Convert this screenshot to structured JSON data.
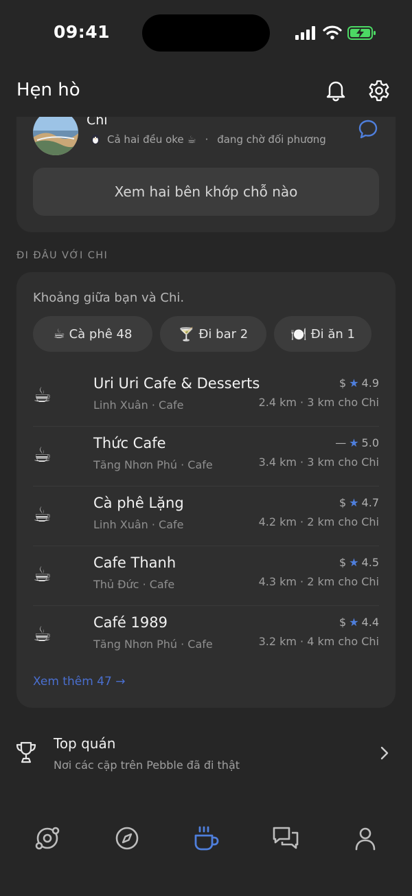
{
  "status": {
    "time": "09:41"
  },
  "header": {
    "title": "Hẹn hò"
  },
  "match": {
    "name": "Chi",
    "status_text": "Cả hai đều oke ☕",
    "separator": "·",
    "waiting_text": "đang chờ đối phương",
    "compare_label": "Xem hai bên khớp chỗ nào"
  },
  "section": {
    "label": "ĐI ĐÂU VỚI CHI"
  },
  "places": {
    "intro": "Khoảng giữa bạn và Chi.",
    "chips": [
      {
        "icon": "☕",
        "label": "Cà phê 48"
      },
      {
        "icon": "🍸",
        "label": "Đi bar 2"
      },
      {
        "icon": "🍽️",
        "label": "Đi ăn 1"
      }
    ],
    "items": [
      {
        "icon": "☕",
        "name": "Uri Uri Cafe & Desserts",
        "sub": "Linh Xuân · Cafe",
        "price": "$",
        "rating": "4.9",
        "dist": "2.4 km · 3 km cho Chi"
      },
      {
        "icon": "☕",
        "name": "Thức Cafe",
        "sub": "Tăng Nhơn Phú · Cafe",
        "price": "—",
        "rating": "5.0",
        "dist": "3.4 km · 3 km cho Chi"
      },
      {
        "icon": "☕",
        "name": "Cà phê Lặng",
        "sub": "Linh Xuân · Cafe",
        "price": "$",
        "rating": "4.7",
        "dist": "4.2 km · 2 km cho Chi"
      },
      {
        "icon": "☕",
        "name": "Cafe Thanh",
        "sub": "Thủ Đức · Cafe",
        "price": "$",
        "rating": "4.5",
        "dist": "4.3 km · 2 km cho Chi"
      },
      {
        "icon": "☕",
        "name": "Café 1989",
        "sub": "Tăng Nhơn Phú · Cafe",
        "price": "$",
        "rating": "4.4",
        "dist": "3.2 km · 4 km cho Chi"
      }
    ],
    "star": "★",
    "see_more": "Xem thêm 47 →"
  },
  "top": {
    "title": "Top quán",
    "subtitle": "Nơi các cặp trên Pebble đã đi thật"
  },
  "tabs": [
    {
      "icon": "orbit-icon"
    },
    {
      "icon": "compass-icon"
    },
    {
      "icon": "coffee-cup-icon",
      "active": true
    },
    {
      "icon": "chat-bubbles-icon"
    },
    {
      "icon": "profile-icon"
    }
  ],
  "colors": {
    "accent": "#4f7fdc",
    "background": "#262626",
    "card": "#2f2f2f"
  }
}
